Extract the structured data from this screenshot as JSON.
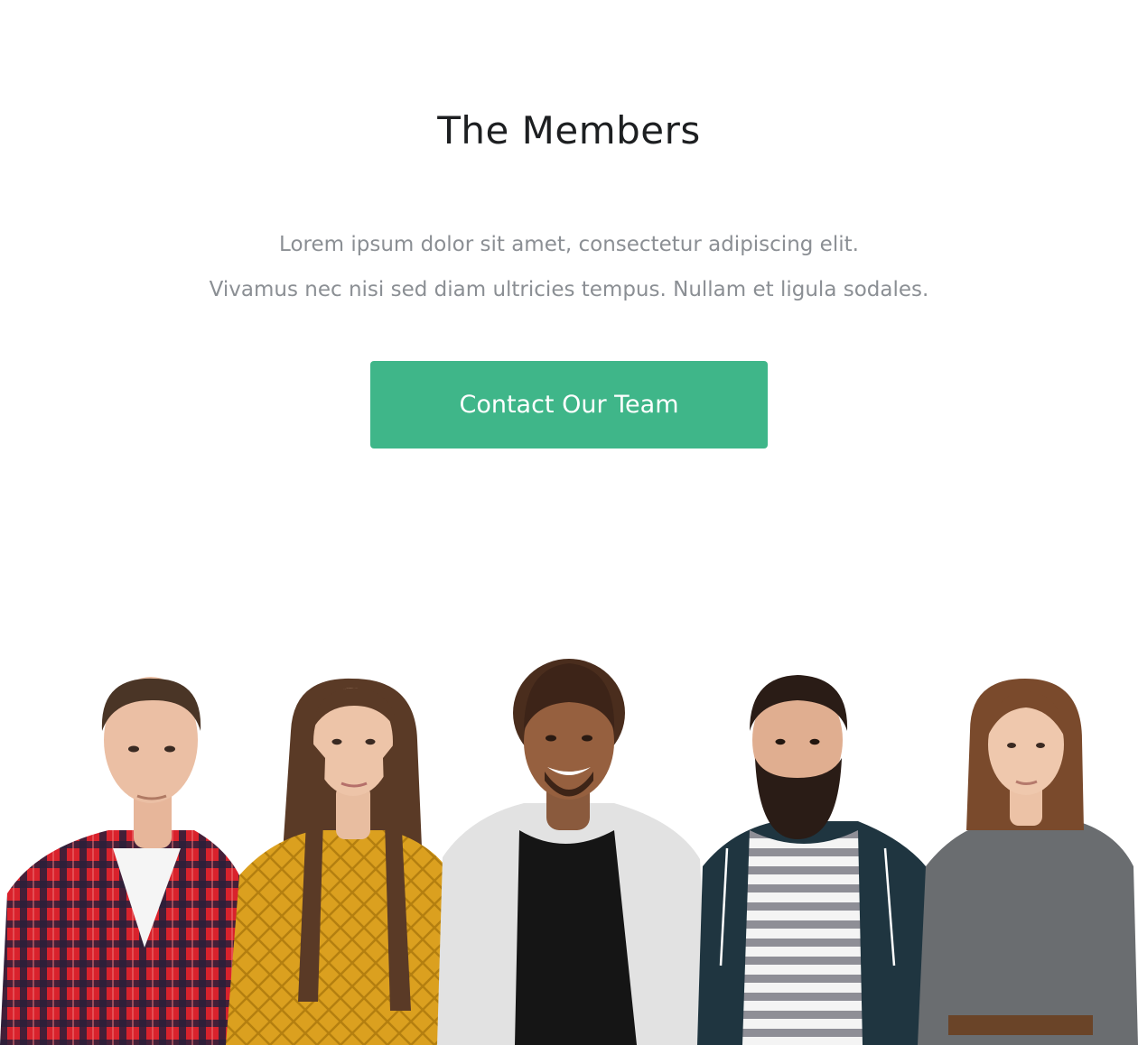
{
  "section": {
    "title": "The Members",
    "description_lines": [
      "Lorem ipsum dolor sit amet, consectetur adipiscing elit.",
      "Vivamus nec nisi sed diam ultricies tempus. Nullam et ligula sodales."
    ],
    "cta_label": "Contact Our Team"
  },
  "colors": {
    "accent": "#3fb689",
    "title": "#1d1f21",
    "body_text": "#8b8f94",
    "background": "#ffffff"
  }
}
